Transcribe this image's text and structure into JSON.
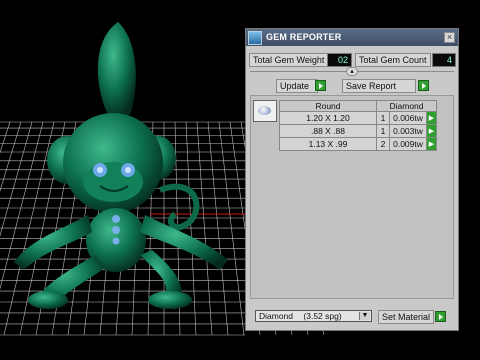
{
  "panel": {
    "title": "GEM REPORTER",
    "close_glyph": "×",
    "total_gem_weight_label": "Total Gem Weight",
    "total_gem_weight_value": "02",
    "total_gem_count_label": "Total Gem Count",
    "total_gem_count_value": "4",
    "collapse_glyph": "▴",
    "update_label": "Update",
    "save_report_label": "Save Report",
    "table": {
      "headers": [
        "Round",
        "Diamond"
      ],
      "rows": [
        {
          "size": "1.20 X 1.20",
          "count": "1",
          "weight": "0.006tw"
        },
        {
          "size": ".88 X .88",
          "count": "1",
          "weight": "0.003tw"
        },
        {
          "size": "1.13 X .99",
          "count": "2",
          "weight": "0.009tw"
        }
      ]
    },
    "material_select": {
      "value": "Diamond",
      "detail": "(3.52 spg)"
    },
    "set_material_label": "Set Material"
  },
  "colors": {
    "monkey": "#0b6b4a",
    "titlebar": "#4a5a75",
    "go_button": "#2fa02f",
    "grid": "#c8c8c8",
    "axis_red": "#c81818"
  },
  "icons": {
    "title": "gem-reporter-logo-icon",
    "close": "close-icon",
    "go": "green-play-arrow-icon",
    "gem": "round-gem-icon",
    "dropdown": "dropdown-arrow-icon"
  }
}
